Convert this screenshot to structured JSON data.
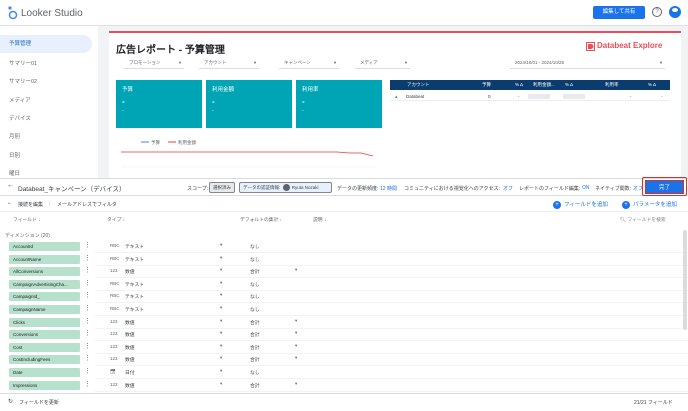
{
  "app": {
    "title": "Looker Studio",
    "share_label": "編集して共有",
    "help": "?"
  },
  "sidebar": {
    "items": [
      {
        "label": "予算管理",
        "active": true
      },
      {
        "label": "サマリー01"
      },
      {
        "label": "サマリー02"
      },
      {
        "label": "メディア"
      },
      {
        "label": "デバイス"
      },
      {
        "label": "月別"
      },
      {
        "label": "日別"
      },
      {
        "label": "曜日"
      }
    ]
  },
  "report": {
    "title": "広告レポート - 予算管理",
    "brand": "Databeat Explore",
    "filters": [
      "プロモーション",
      "アカウント",
      "キャンペーン",
      "メディア"
    ],
    "date_range": "2024/10/01 - 2024/10/28",
    "cards": [
      {
        "label": "予算",
        "value": "-",
        "sub": "-"
      },
      {
        "label": "利用金額",
        "value": "-",
        "sub": "-"
      },
      {
        "label": "利用率",
        "value": "-",
        "sub": "-"
      }
    ],
    "table": {
      "headers": [
        "アカウント",
        "予算",
        "% Δ",
        "利用金額...",
        "% Δ",
        "利用率",
        "% Δ"
      ],
      "row": {
        "account": "Databeat",
        "budget": "0",
        "dash": "-"
      }
    },
    "chart": {
      "legend": [
        "予算",
        "利用金額"
      ],
      "colors": [
        "#4285f4",
        "#db4437"
      ]
    }
  },
  "editor": {
    "back_title": "Databeat_キャンペーン（デバイス）",
    "scope_label": "スコープ:",
    "scope_chip": "選択済み",
    "auth_chip": "データの認証情報:",
    "auth_user": "Ryuta Nozaki",
    "freshness_label": "データの更新頻度:",
    "freshness_value": "12 時間",
    "community_label": "コミュニティにおける視覚化へのアクセス:",
    "community_value": "オフ",
    "field_edit_label": "レポートのフィールド編集:",
    "field_edit_value": "ON",
    "native_label": "ネイティブ関数:",
    "native_value": "オフ",
    "done_label": "完了",
    "connection_edit": "接続を編集",
    "filter_email": "メールアドレスでフィルタ",
    "add_field": "フィールドを追加",
    "add_param": "パラメータを追加",
    "columns": {
      "field": "フィールド",
      "type": "タイプ",
      "default_agg": "デフォルトの集計",
      "description": "説明"
    },
    "search_placeholder": "フィールドを検索",
    "dimension_header": "ディメンション (20)",
    "fields": [
      {
        "name": "AccountId",
        "type_icon": "RBC",
        "type": "テキスト",
        "agg": "なし",
        "agg_dd": false
      },
      {
        "name": "AccountName",
        "type_icon": "RBC",
        "type": "テキスト",
        "agg": "なし",
        "agg_dd": false
      },
      {
        "name": "AllConversions",
        "type_icon": "123",
        "type": "数値",
        "agg": "合計",
        "agg_dd": true
      },
      {
        "name": "CampaignAdvertisingCha...",
        "type_icon": "RBC",
        "type": "テキスト",
        "agg": "なし",
        "agg_dd": false
      },
      {
        "name": "CampaignId_",
        "type_icon": "RBC",
        "type": "テキスト",
        "agg": "なし",
        "agg_dd": false
      },
      {
        "name": "CampaignName",
        "type_icon": "RBC",
        "type": "テキスト",
        "agg": "なし",
        "agg_dd": false
      },
      {
        "name": "Clicks",
        "type_icon": "123",
        "type": "数値",
        "agg": "合計",
        "agg_dd": true
      },
      {
        "name": "Conversions",
        "type_icon": "123",
        "type": "数値",
        "agg": "合計",
        "agg_dd": true
      },
      {
        "name": "Cost",
        "type_icon": "123",
        "type": "数値",
        "agg": "合計",
        "agg_dd": true
      },
      {
        "name": "CostIncludingFees",
        "type_icon": "123",
        "type": "数値",
        "agg": "合計",
        "agg_dd": true
      },
      {
        "name": "Date",
        "type_icon": "cal",
        "type": "日付",
        "agg": "なし",
        "agg_dd": false
      },
      {
        "name": "Impressions",
        "type_icon": "123",
        "type": "数値",
        "agg": "合計",
        "agg_dd": true
      }
    ],
    "footer_refresh": "フィールドを更新",
    "footer_count": "21/21 フィールド"
  }
}
